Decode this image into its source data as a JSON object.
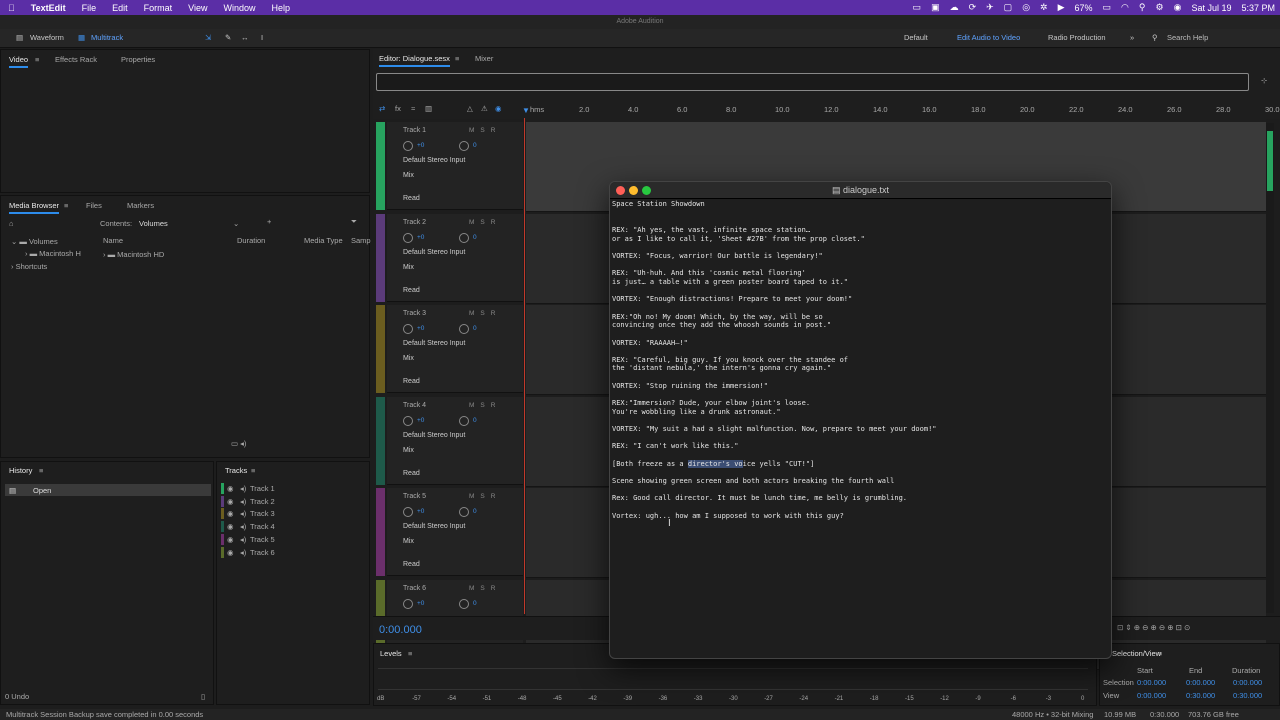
{
  "menubar": {
    "apple": "",
    "app": "TextEdit",
    "items": [
      "File",
      "Edit",
      "Format",
      "View",
      "Window",
      "Help"
    ],
    "battery": "67%",
    "date": "Sat Jul 19",
    "time": "5:37 PM"
  },
  "window_title": "Adobe Audition",
  "toolbar": {
    "waveform": "Waveform",
    "multitrack": "Multitrack",
    "workspaces": [
      "Default",
      "Edit Audio to Video",
      "Radio Production"
    ],
    "search_placeholder": "Search Help",
    "more": "»"
  },
  "left_top_tabs": [
    "Video",
    "Effects Rack",
    "Properties"
  ],
  "media_browser": {
    "tabs": [
      "Media Browser",
      "Files",
      "Markers"
    ],
    "contents_label": "Contents:",
    "contents_value": "Volumes",
    "cols": [
      "Name",
      "Duration",
      "Media Type",
      "Samp"
    ],
    "tree": [
      "Volumes",
      "Macintosh H",
      "Shortcuts"
    ],
    "files": [
      "Macintosh HD"
    ]
  },
  "history": {
    "title": "History",
    "item": "Open",
    "undo": "0 Undo"
  },
  "tracks_panel": {
    "title": "Tracks",
    "items": [
      "Track 1",
      "Track 2",
      "Track 3",
      "Track 4",
      "Track 5",
      "Track 6"
    ]
  },
  "editor": {
    "tabs": [
      "Editor: Dialogue.sesx",
      "Mixer"
    ],
    "ruler": [
      "hms",
      "2.0",
      "4.0",
      "6.0",
      "8.0",
      "10.0",
      "12.0",
      "14.0",
      "16.0",
      "18.0",
      "20.0",
      "22.0",
      "24.0",
      "26.0",
      "28.0",
      "30.0"
    ],
    "time": "0:00.000"
  },
  "tracks": [
    {
      "name": "Track 1",
      "vol": "+0",
      "pan": "0",
      "input": "Default Stereo Input",
      "mix": "Mix",
      "mode": "Read",
      "msr": "MSR",
      "color": "#27a35f"
    },
    {
      "name": "Track 2",
      "vol": "+0",
      "pan": "0",
      "input": "Default Stereo Input",
      "mix": "Mix",
      "mode": "Read",
      "msr": "MSR",
      "color": "#5b3b7a"
    },
    {
      "name": "Track 3",
      "vol": "+0",
      "pan": "0",
      "input": "Default Stereo Input",
      "mix": "Mix",
      "mode": "Read",
      "msr": "MSR",
      "color": "#6b5d1f"
    },
    {
      "name": "Track 4",
      "vol": "+0",
      "pan": "0",
      "input": "Default Stereo Input",
      "mix": "Mix",
      "mode": "Read",
      "msr": "MSR",
      "color": "#1e5a4a"
    },
    {
      "name": "Track 5",
      "vol": "+0",
      "pan": "0",
      "input": "Default Stereo Input",
      "mix": "Mix",
      "mode": "Read",
      "msr": "MSR",
      "color": "#6b2f6b"
    },
    {
      "name": "Track 6",
      "vol": "+0",
      "pan": "0",
      "input": "",
      "mix": "",
      "mode": "",
      "msr": "MSR",
      "color": "#5a6b2a"
    }
  ],
  "levels": {
    "title": "Levels",
    "scale": [
      "dB",
      "-57",
      "-54",
      "-51",
      "-48",
      "-45",
      "-42",
      "-39",
      "-36",
      "-33",
      "-30",
      "-27",
      "-24",
      "-21",
      "-18",
      "-15",
      "-12",
      "-9",
      "-6",
      "-3",
      "0"
    ]
  },
  "selection_view": {
    "title": "Selection/View",
    "cols": [
      "Start",
      "End",
      "Duration"
    ],
    "rows": [
      {
        "label": "Selection",
        "start": "0:00.000",
        "end": "0:00.000",
        "dur": "0:00.000"
      },
      {
        "label": "View",
        "start": "0:00.000",
        "end": "0:30.000",
        "dur": "0:30.000"
      }
    ]
  },
  "status": {
    "left": "Multitrack Session Backup save completed in 0.00 seconds",
    "format": "48000 Hz • 32-bit Mixing",
    "mem": "10.99 MB",
    "dur": "0:30.000",
    "free": "703.76 GB free"
  },
  "textedit": {
    "title": "dialogue.txt",
    "l1": "Space Station Showdown",
    "l2": "REX: \"Ah yes, the vast, infinite space station…\nor as I like to call it, 'Sheet #27B' from the prop closet.\"",
    "l3": "VORTEX: \"Focus, warrior! Our battle is legendary!\"",
    "l4": "REX: \"Uh-huh. And this 'cosmic metal flooring'\nis just… a table with a green poster board taped to it.\"",
    "l5": "VORTEX: \"Enough distractions! Prepare to meet your doom!\"",
    "l6": "REX:\"Oh no! My doom! Which, by the way, will be so\nconvincing once they add the whoosh sounds in post.\"",
    "l7": "VORTEX: \"RAAAAH—!\"",
    "l8": "REX: \"Careful, big guy. If you knock over the standee of\nthe 'distant nebula,' the intern's gonna cry again.\"",
    "l9": "VORTEX: \"Stop ruining the immersion!\"",
    "l10": "REX:\"Immersion? Dude, your elbow joint's loose.\nYou're wobbling like a drunk astronaut.\"",
    "l11": "VORTEX: \"My suit a had a slight malfunction. Now, prepare to meet your doom!\"",
    "l12": "REX: \"I can't work like this.\"",
    "l13a": "[Both freeze as a ",
    "l13b": "director's vo",
    "l13c": "ice yells \"CUT!\"]",
    "l14": "Scene showing green screen and both actors breaking the fourth wall",
    "l15": "Rex: Good call director. It must be lunch time, me belly is grumbling.",
    "l16": "Vortex: ugh... how am I supposed to work with this guy?"
  }
}
